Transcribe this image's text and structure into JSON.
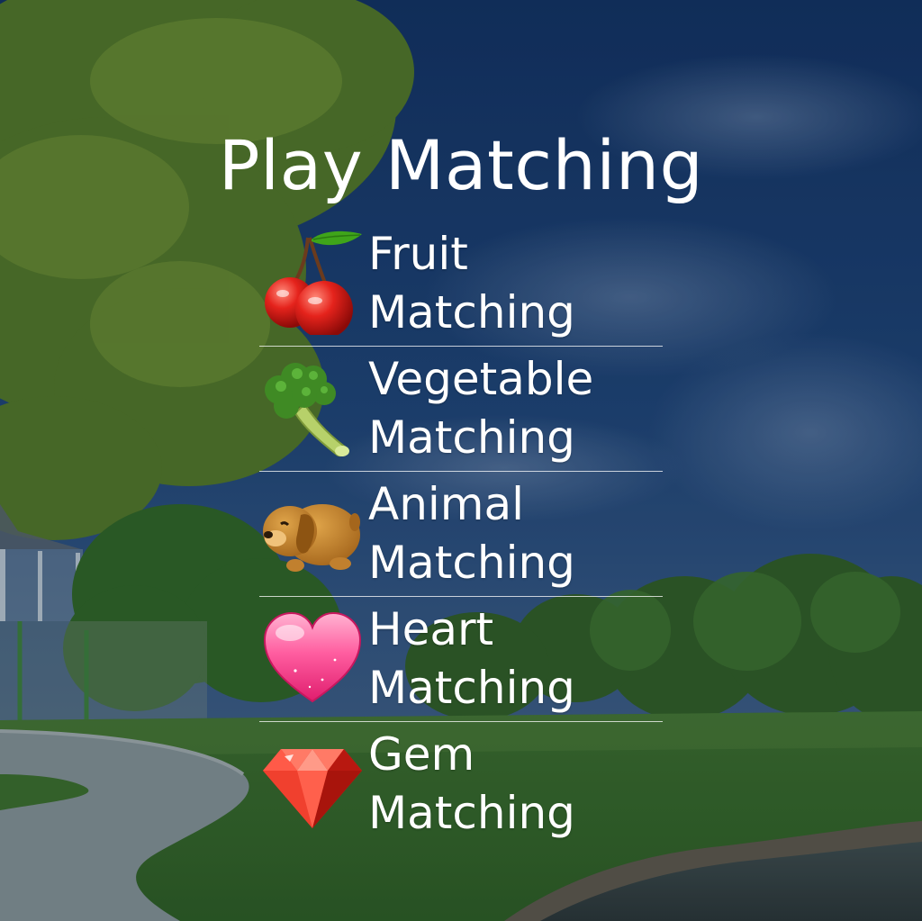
{
  "screen": {
    "title": "Play Matching"
  },
  "menu": {
    "items": [
      {
        "line1": "Fruit",
        "line2": "Matching",
        "icon": "cherry-icon"
      },
      {
        "line1": "Vegetable",
        "line2": "Matching",
        "icon": "broccoli-icon"
      },
      {
        "line1": "Animal",
        "line2": "Matching",
        "icon": "puppy-icon"
      },
      {
        "line1": "Heart",
        "line2": "Matching",
        "icon": "heart-icon"
      },
      {
        "line1": "Gem",
        "line2": "Matching",
        "icon": "gem-icon"
      }
    ]
  },
  "colors": {
    "sky": "#1f3f70",
    "foliage": "#5a7a2a",
    "grass": "#3f6a2c",
    "text": "#ffffff",
    "divider": "#ffffff"
  }
}
